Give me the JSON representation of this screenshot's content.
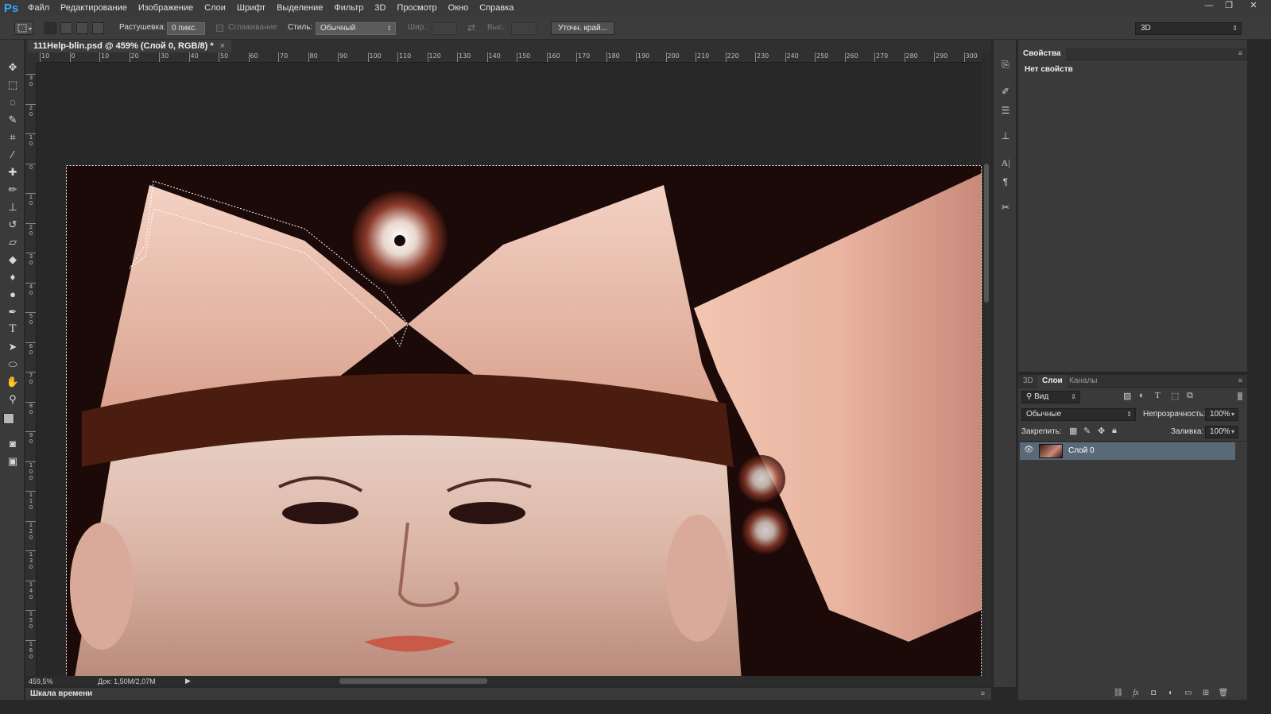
{
  "app": {
    "logo": "Ps"
  },
  "menu": [
    "Файл",
    "Редактирование",
    "Изображение",
    "Слои",
    "Шрифт",
    "Выделение",
    "Фильтр",
    "3D",
    "Просмотр",
    "Окно",
    "Справка"
  ],
  "window_controls": {
    "minimize": "—",
    "restore": "❐",
    "close": "✕"
  },
  "options": {
    "feather_label": "Растушевка:",
    "feather_value": "0 пикс.",
    "antialias_label": "Сглаживание",
    "style_label": "Стиль:",
    "style_value": "Обычный",
    "width_label": "Шир.:",
    "swap_icon": "⇄",
    "height_label": "Выс.:",
    "refine_edge": "Уточн. край...",
    "workspace": "3D"
  },
  "document": {
    "tab_title": "111Help-blin.psd @ 459% (Слой 0, RGB/8) *",
    "tab_close": "×",
    "zoom": "459,5%",
    "doc_size": "Док: 1,50M/2,07M"
  },
  "rulers": {
    "h": [
      "10",
      "0",
      "10",
      "20",
      "30",
      "40",
      "50",
      "60",
      "70",
      "80",
      "90",
      "100",
      "110",
      "120",
      "130",
      "140",
      "150",
      "160",
      "170",
      "180",
      "190",
      "200",
      "210",
      "220",
      "230",
      "240",
      "250",
      "260",
      "270",
      "280",
      "290",
      "300"
    ],
    "v": [
      "3 0",
      "2 0",
      "1 0",
      "0",
      "1 0",
      "2 0",
      "3 0",
      "4 0",
      "5 0",
      "6 0",
      "7 0",
      "8 0",
      "9 0",
      "1 0 0",
      "1 1 0",
      "1 2 0",
      "1 3 0",
      "1 4 0",
      "1 5 0",
      "1 6 0"
    ]
  },
  "timeline": {
    "label": "Шкала времени"
  },
  "properties": {
    "tab": "Свойства",
    "empty_text": "Нет свойств"
  },
  "layers_panel": {
    "tabs": [
      "3D",
      "Слои",
      "Каналы"
    ],
    "filter_kind": "Вид",
    "blend_mode": "Обычные",
    "opacity_label": "Непрозрачность:",
    "opacity_value": "100%",
    "lock_label": "Закрепить:",
    "fill_label": "Заливка:",
    "fill_value": "100%",
    "layers": [
      {
        "name": "Слой 0",
        "visible": true,
        "selected": true
      }
    ]
  },
  "colors": {
    "accent": "#31a8ff",
    "selected_layer": "#596978",
    "panel_bg": "#3a3a3a"
  }
}
